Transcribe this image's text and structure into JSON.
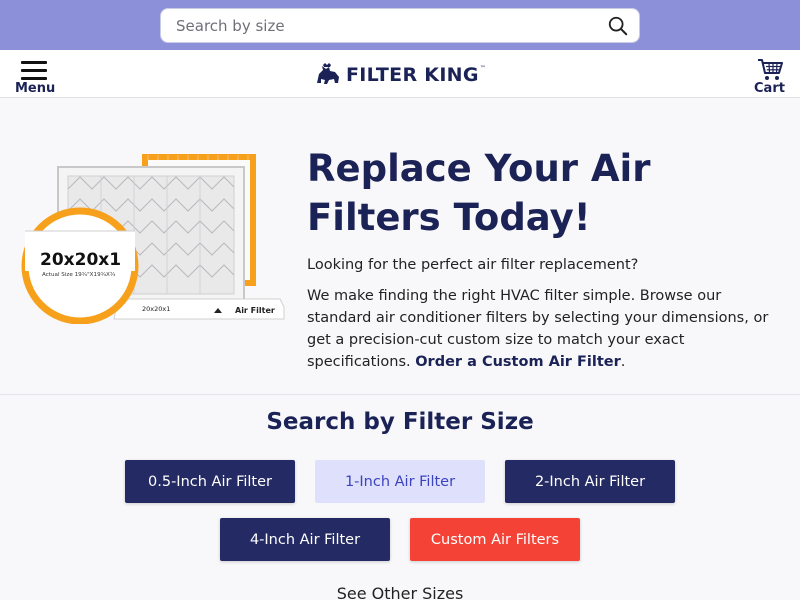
{
  "search": {
    "placeholder": "Search by size",
    "icon": "search-icon"
  },
  "header": {
    "menu_label": "Menu",
    "logo_text": "FILTER KING",
    "logo_tm": "™",
    "cart_label": "Cart"
  },
  "hero": {
    "title": "Replace Your Air Filters Today!",
    "question": "Looking for the perfect air filter replacement?",
    "body": "We make finding the right HVAC filter simple. Browse our standard air conditioner filters by selecting your dimensions, or get a precision-cut custom size to match your exact specifications. ",
    "link": "Order a Custom Air Filter",
    "link_suffix": ".",
    "badge_size": "20x20x1",
    "badge_actual": "Actual Size 19¾\"X19¾X¾",
    "filter_label_size": "20x20x1",
    "filter_label_brand": "Air Filter"
  },
  "size_section": {
    "title": "Search by Filter Size",
    "buttons": [
      "0.5-Inch Air Filter",
      "1-Inch Air Filter",
      "2-Inch Air Filter",
      "4-Inch Air Filter",
      "Custom Air Filters"
    ],
    "other": "See Other Sizes"
  },
  "colors": {
    "brand_navy": "#1b2256",
    "search_strip": "#8b90d9",
    "button_dark": "#242a63",
    "button_light": "#dfe0fb",
    "button_red": "#f44336",
    "accent_orange": "#f7a01c"
  }
}
